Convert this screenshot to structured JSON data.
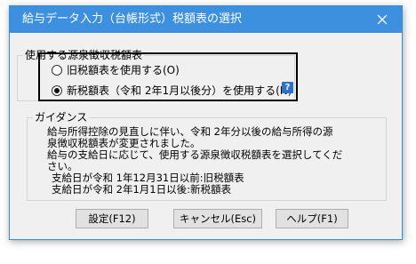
{
  "window": {
    "title": "給与データ入力（台帳形式）税額表の選択",
    "close_icon": "close-icon"
  },
  "source_group": {
    "label": "使用する源泉徴収税額表",
    "options": [
      {
        "label": "旧税額表を使用する(O)",
        "selected": false
      },
      {
        "label": "新税額表（令和 2年1月以後分）を使用する(N)",
        "selected": true
      }
    ],
    "help_icon": "?"
  },
  "guidance": {
    "label": "ガイダンス",
    "lines": [
      "給与所得控除の見直しに伴い、令和 2年分以後の給与所得の源",
      "泉徴収税額表が変更されました。",
      "給与の支給日に応じて、使用する源泉徴収税額表を選択してくだ",
      "さい。",
      "支給日が令和 1年12月31日以前:旧税額表",
      "支給日が令和 2年1月1日以後:新税額表"
    ]
  },
  "buttons": {
    "ok": "設定(F12)",
    "cancel": "キャンセル(Esc)",
    "help": "ヘルプ(F1)"
  },
  "colors": {
    "titlebar": "#3d8fe0",
    "dialog_bg": "#f0f0f0",
    "help_icon": "#2b72cf"
  }
}
